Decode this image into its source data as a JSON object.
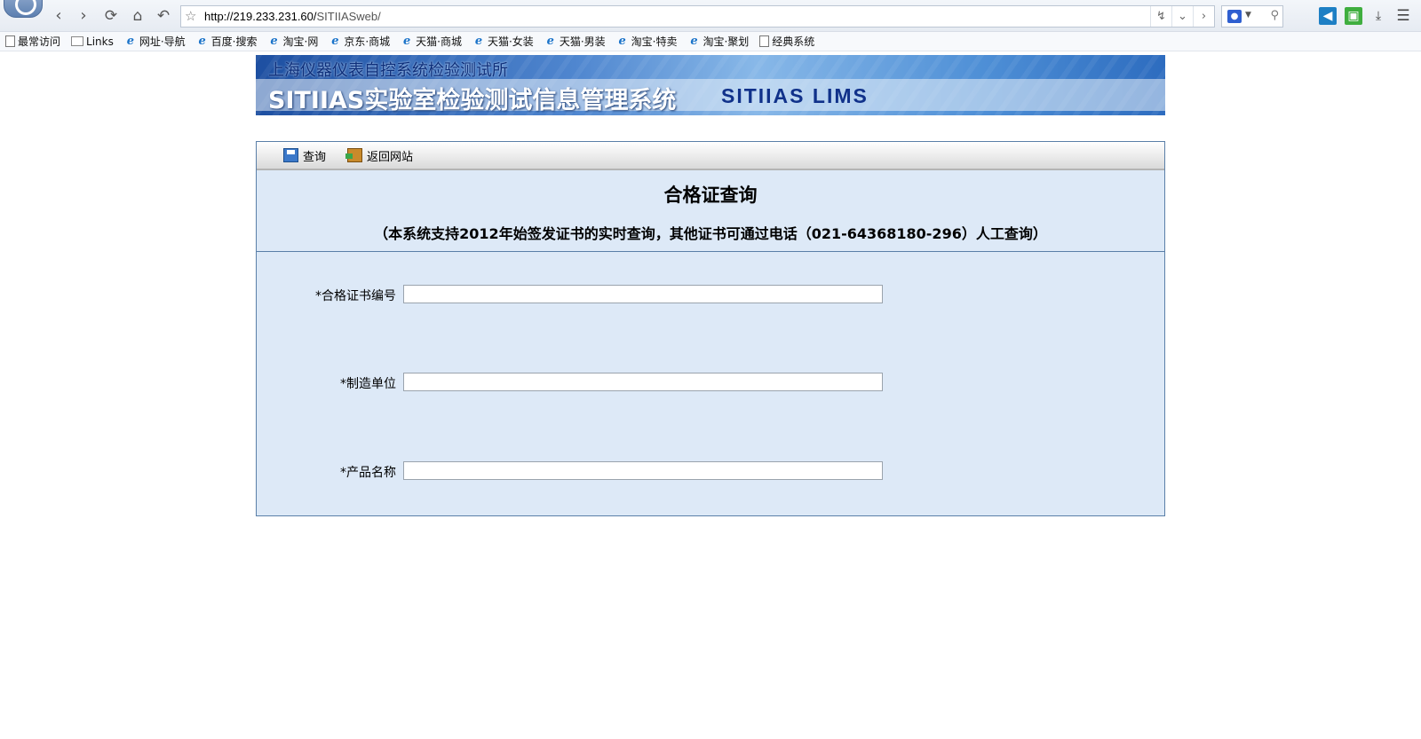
{
  "browser": {
    "url_host": "http://219.233.231.60/",
    "url_path": "SITIIASweb/",
    "icons": [
      "back-icon",
      "forward-icon",
      "refresh-icon",
      "home-icon",
      "undo-icon",
      "star-icon",
      "lightning-icon",
      "dropdown-icon",
      "next-icon",
      "baidu-paw-icon",
      "search-icon",
      "share-icon",
      "crop-icon",
      "download-icon",
      "menu-icon"
    ]
  },
  "bookmarks": [
    {
      "label": "最常访问",
      "icon": "page-icon"
    },
    {
      "label": "Links",
      "icon": "folder-icon"
    },
    {
      "label": "网址·导航",
      "icon": "ie-icon"
    },
    {
      "label": "百度·搜索",
      "icon": "ie-icon"
    },
    {
      "label": "淘宝·网",
      "icon": "ie-icon"
    },
    {
      "label": "京东·商城",
      "icon": "ie-icon"
    },
    {
      "label": "天猫·商城",
      "icon": "ie-icon"
    },
    {
      "label": "天猫·女装",
      "icon": "ie-icon"
    },
    {
      "label": "天猫·男装",
      "icon": "ie-icon"
    },
    {
      "label": "淘宝·特卖",
      "icon": "ie-icon"
    },
    {
      "label": "淘宝·聚划",
      "icon": "ie-icon"
    },
    {
      "label": "经典系统",
      "icon": "page-icon"
    }
  ],
  "banner": {
    "institute": "上海仪器仪表自控系统检验测试所",
    "title": "SITIIAS实验室检验测试信息管理系统",
    "lims": "SITIIAS LIMS"
  },
  "toolbar": {
    "query_label": "查询",
    "return_label": "返回网站"
  },
  "header": {
    "title": "合格证查询",
    "subtitle": "（本系统支持2012年始签发证书的实时查询，其他证书可通过电话（021-64368180-296）人工查询）"
  },
  "form": {
    "fields": [
      {
        "label": "*合格证书编号",
        "value": ""
      },
      {
        "label": "*制造单位",
        "value": ""
      },
      {
        "label": "*产品名称",
        "value": ""
      }
    ]
  },
  "colors": {
    "panel_bg": "#dde9f7",
    "panel_border": "#5a7fa8",
    "banner_blue": "#1d4fa1"
  }
}
